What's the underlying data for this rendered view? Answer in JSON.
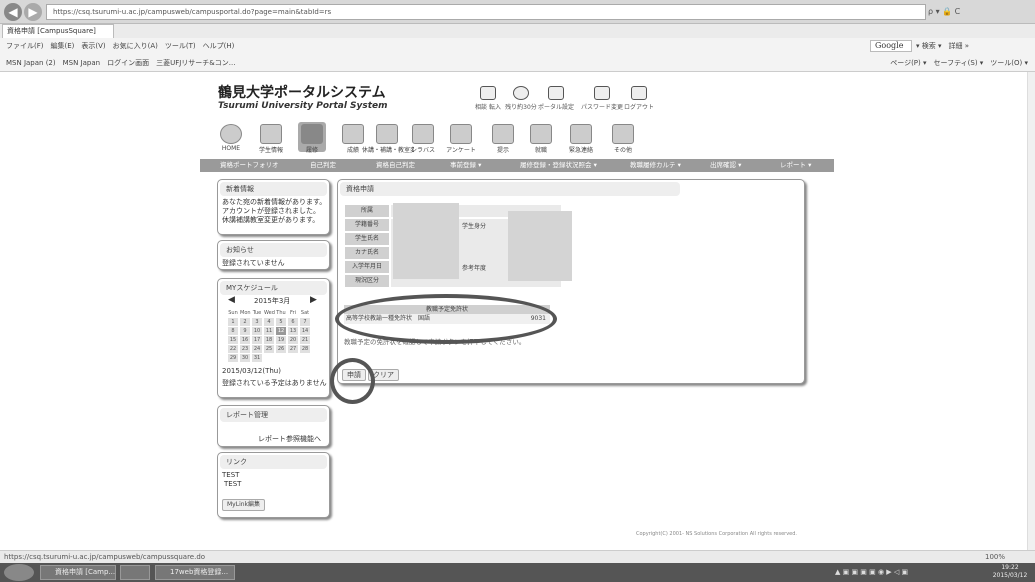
{
  "browser": {
    "address": "https://csq.tsurumi-u.ac.jp/campusweb/campusportal.do?page=main&tabId=rs",
    "tools": "ρ ▾ 🔒 C",
    "tab": "資格申請 [CampusSquare]",
    "menu": "ファイル(F)　編集(E)　表示(V)　お気に入り(A)　ツール(T)　ヘルプ(H)",
    "search_engine": "Google",
    "search_extra": "▾ 検索 ▾　詳細 »",
    "favorites": "MSN Japan (2)　MSN Japan　ログイン画面　三菱UFJリサーチ&コン...",
    "favorites_right": "ページ(P) ▾　セーフティ(S) ▾　ツール(O) ▾",
    "status_url": "https://csq.tsurumi-u.ac.jp/campusweb/campussquare.do",
    "zoom": "100%",
    "taskbar": [
      "資格申請 [Camp...",
      "",
      "17web資格登録..."
    ],
    "clock_time": "19:22",
    "clock_date": "2015/03/12"
  },
  "portal": {
    "name_ja": "鶴見大学ポータルシステム",
    "name_en": "Tsurumi University Portal System",
    "header_links": [
      "相談 転入",
      "残り約30分",
      "ポータル設定",
      "パスワード変更",
      "ログアウト"
    ],
    "main_nav": [
      "HOME",
      "学生情報",
      "履修",
      "成績",
      "休講・補講・教室変更",
      "シラバス",
      "アンケート",
      "提示",
      "就職",
      "緊急連絡",
      "その他"
    ],
    "sub_nav": [
      "資格ポートフォリオ",
      "自己判定",
      "資格自己判定",
      "事前登録 ▾",
      "履修登録・登録状況照会 ▾",
      "教職履修カルテ ▾",
      "出席確認 ▾",
      "レポート ▾"
    ]
  },
  "sidebar": {
    "news_title": "新着情報",
    "news_body": [
      "あなた宛の新着情報があります。",
      "アカウントが登録されました。",
      "休講補講教室変更があります。"
    ],
    "notice_title": "お知らせ",
    "notice_body": "登録されていません",
    "schedule_title": "MYスケジュール",
    "calendar_month": "2015年3月",
    "calendar_days": [
      "Sun",
      "Mon",
      "Tue",
      "Wed",
      "Thu",
      "Fri",
      "Sat"
    ],
    "calendar_dates": [
      "1",
      "2",
      "3",
      "4",
      "5",
      "6",
      "7",
      "8",
      "9",
      "10",
      "11",
      "12",
      "13",
      "14",
      "15",
      "16",
      "17",
      "18",
      "19",
      "20",
      "21",
      "22",
      "23",
      "24",
      "25",
      "26",
      "27",
      "28",
      "29",
      "30",
      "31"
    ],
    "schedule_date": "2015/03/12(Thu)",
    "schedule_empty": "登録されている予定はありません",
    "report_title": "レポート管理",
    "report_link": "レポート参照機能へ",
    "links_title": "リンク",
    "links": [
      "TEST",
      "TEST"
    ],
    "mylink_edit": "MyLink編集"
  },
  "main": {
    "title": "資格申請",
    "form_labels": [
      "所属",
      "学籍番号",
      "学生氏名",
      "カナ氏名",
      "入学年月日",
      "現況区分"
    ],
    "col2_labels": [
      "学生身分",
      "参考年度"
    ],
    "table_header": "教職予定免許状",
    "table_row": "高等学校教諭一種免許状　国語",
    "table_row_code": "9031",
    "note": "教職予定の免許状を確認して申請ボタンを押下してください。",
    "apply_button": "申請",
    "clear_button": "クリア",
    "copyright": "Copyright(C) 2001- NS Solutions Corporation All rights reserved."
  }
}
